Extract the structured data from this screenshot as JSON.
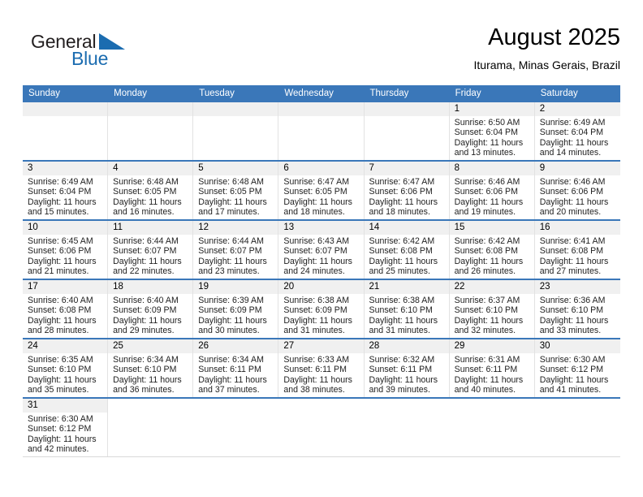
{
  "brand": {
    "name_part1": "General",
    "name_part2": "Blue",
    "triangle_color": "#1b6cb0",
    "text_color": "#231f20"
  },
  "header": {
    "title": "August 2025",
    "subtitle": "Iturama, Minas Gerais, Brazil"
  },
  "theme": {
    "header_row_bg": "#3a77b9",
    "header_row_text": "#ffffff",
    "daynum_bg": "#f0f0f0",
    "grid_line": "#e2e2e2",
    "week_divider": "#3a77b9"
  },
  "weekdays": [
    "Sunday",
    "Monday",
    "Tuesday",
    "Wednesday",
    "Thursday",
    "Friday",
    "Saturday"
  ],
  "weeks": [
    [
      {
        "day": "",
        "sunrise": "",
        "sunset": "",
        "daylight_line1": "",
        "daylight_line2": "",
        "type": "empty"
      },
      {
        "day": "",
        "sunrise": "",
        "sunset": "",
        "daylight_line1": "",
        "daylight_line2": "",
        "type": "empty"
      },
      {
        "day": "",
        "sunrise": "",
        "sunset": "",
        "daylight_line1": "",
        "daylight_line2": "",
        "type": "empty"
      },
      {
        "day": "",
        "sunrise": "",
        "sunset": "",
        "daylight_line1": "",
        "daylight_line2": "",
        "type": "empty"
      },
      {
        "day": "",
        "sunrise": "",
        "sunset": "",
        "daylight_line1": "",
        "daylight_line2": "",
        "type": "empty"
      },
      {
        "day": "1",
        "sunrise": "Sunrise: 6:50 AM",
        "sunset": "Sunset: 6:04 PM",
        "daylight_line1": "Daylight: 11 hours",
        "daylight_line2": "and 13 minutes.",
        "type": "day"
      },
      {
        "day": "2",
        "sunrise": "Sunrise: 6:49 AM",
        "sunset": "Sunset: 6:04 PM",
        "daylight_line1": "Daylight: 11 hours",
        "daylight_line2": "and 14 minutes.",
        "type": "day"
      }
    ],
    [
      {
        "day": "3",
        "sunrise": "Sunrise: 6:49 AM",
        "sunset": "Sunset: 6:04 PM",
        "daylight_line1": "Daylight: 11 hours",
        "daylight_line2": "and 15 minutes.",
        "type": "day"
      },
      {
        "day": "4",
        "sunrise": "Sunrise: 6:48 AM",
        "sunset": "Sunset: 6:05 PM",
        "daylight_line1": "Daylight: 11 hours",
        "daylight_line2": "and 16 minutes.",
        "type": "day"
      },
      {
        "day": "5",
        "sunrise": "Sunrise: 6:48 AM",
        "sunset": "Sunset: 6:05 PM",
        "daylight_line1": "Daylight: 11 hours",
        "daylight_line2": "and 17 minutes.",
        "type": "day"
      },
      {
        "day": "6",
        "sunrise": "Sunrise: 6:47 AM",
        "sunset": "Sunset: 6:05 PM",
        "daylight_line1": "Daylight: 11 hours",
        "daylight_line2": "and 18 minutes.",
        "type": "day"
      },
      {
        "day": "7",
        "sunrise": "Sunrise: 6:47 AM",
        "sunset": "Sunset: 6:06 PM",
        "daylight_line1": "Daylight: 11 hours",
        "daylight_line2": "and 18 minutes.",
        "type": "day"
      },
      {
        "day": "8",
        "sunrise": "Sunrise: 6:46 AM",
        "sunset": "Sunset: 6:06 PM",
        "daylight_line1": "Daylight: 11 hours",
        "daylight_line2": "and 19 minutes.",
        "type": "day"
      },
      {
        "day": "9",
        "sunrise": "Sunrise: 6:46 AM",
        "sunset": "Sunset: 6:06 PM",
        "daylight_line1": "Daylight: 11 hours",
        "daylight_line2": "and 20 minutes.",
        "type": "day"
      }
    ],
    [
      {
        "day": "10",
        "sunrise": "Sunrise: 6:45 AM",
        "sunset": "Sunset: 6:06 PM",
        "daylight_line1": "Daylight: 11 hours",
        "daylight_line2": "and 21 minutes.",
        "type": "day"
      },
      {
        "day": "11",
        "sunrise": "Sunrise: 6:44 AM",
        "sunset": "Sunset: 6:07 PM",
        "daylight_line1": "Daylight: 11 hours",
        "daylight_line2": "and 22 minutes.",
        "type": "day"
      },
      {
        "day": "12",
        "sunrise": "Sunrise: 6:44 AM",
        "sunset": "Sunset: 6:07 PM",
        "daylight_line1": "Daylight: 11 hours",
        "daylight_line2": "and 23 minutes.",
        "type": "day"
      },
      {
        "day": "13",
        "sunrise": "Sunrise: 6:43 AM",
        "sunset": "Sunset: 6:07 PM",
        "daylight_line1": "Daylight: 11 hours",
        "daylight_line2": "and 24 minutes.",
        "type": "day"
      },
      {
        "day": "14",
        "sunrise": "Sunrise: 6:42 AM",
        "sunset": "Sunset: 6:08 PM",
        "daylight_line1": "Daylight: 11 hours",
        "daylight_line2": "and 25 minutes.",
        "type": "day"
      },
      {
        "day": "15",
        "sunrise": "Sunrise: 6:42 AM",
        "sunset": "Sunset: 6:08 PM",
        "daylight_line1": "Daylight: 11 hours",
        "daylight_line2": "and 26 minutes.",
        "type": "day"
      },
      {
        "day": "16",
        "sunrise": "Sunrise: 6:41 AM",
        "sunset": "Sunset: 6:08 PM",
        "daylight_line1": "Daylight: 11 hours",
        "daylight_line2": "and 27 minutes.",
        "type": "day"
      }
    ],
    [
      {
        "day": "17",
        "sunrise": "Sunrise: 6:40 AM",
        "sunset": "Sunset: 6:08 PM",
        "daylight_line1": "Daylight: 11 hours",
        "daylight_line2": "and 28 minutes.",
        "type": "day"
      },
      {
        "day": "18",
        "sunrise": "Sunrise: 6:40 AM",
        "sunset": "Sunset: 6:09 PM",
        "daylight_line1": "Daylight: 11 hours",
        "daylight_line2": "and 29 minutes.",
        "type": "day"
      },
      {
        "day": "19",
        "sunrise": "Sunrise: 6:39 AM",
        "sunset": "Sunset: 6:09 PM",
        "daylight_line1": "Daylight: 11 hours",
        "daylight_line2": "and 30 minutes.",
        "type": "day"
      },
      {
        "day": "20",
        "sunrise": "Sunrise: 6:38 AM",
        "sunset": "Sunset: 6:09 PM",
        "daylight_line1": "Daylight: 11 hours",
        "daylight_line2": "and 31 minutes.",
        "type": "day"
      },
      {
        "day": "21",
        "sunrise": "Sunrise: 6:38 AM",
        "sunset": "Sunset: 6:10 PM",
        "daylight_line1": "Daylight: 11 hours",
        "daylight_line2": "and 31 minutes.",
        "type": "day"
      },
      {
        "day": "22",
        "sunrise": "Sunrise: 6:37 AM",
        "sunset": "Sunset: 6:10 PM",
        "daylight_line1": "Daylight: 11 hours",
        "daylight_line2": "and 32 minutes.",
        "type": "day"
      },
      {
        "day": "23",
        "sunrise": "Sunrise: 6:36 AM",
        "sunset": "Sunset: 6:10 PM",
        "daylight_line1": "Daylight: 11 hours",
        "daylight_line2": "and 33 minutes.",
        "type": "day"
      }
    ],
    [
      {
        "day": "24",
        "sunrise": "Sunrise: 6:35 AM",
        "sunset": "Sunset: 6:10 PM",
        "daylight_line1": "Daylight: 11 hours",
        "daylight_line2": "and 35 minutes.",
        "type": "day"
      },
      {
        "day": "25",
        "sunrise": "Sunrise: 6:34 AM",
        "sunset": "Sunset: 6:10 PM",
        "daylight_line1": "Daylight: 11 hours",
        "daylight_line2": "and 36 minutes.",
        "type": "day"
      },
      {
        "day": "26",
        "sunrise": "Sunrise: 6:34 AM",
        "sunset": "Sunset: 6:11 PM",
        "daylight_line1": "Daylight: 11 hours",
        "daylight_line2": "and 37 minutes.",
        "type": "day"
      },
      {
        "day": "27",
        "sunrise": "Sunrise: 6:33 AM",
        "sunset": "Sunset: 6:11 PM",
        "daylight_line1": "Daylight: 11 hours",
        "daylight_line2": "and 38 minutes.",
        "type": "day"
      },
      {
        "day": "28",
        "sunrise": "Sunrise: 6:32 AM",
        "sunset": "Sunset: 6:11 PM",
        "daylight_line1": "Daylight: 11 hours",
        "daylight_line2": "and 39 minutes.",
        "type": "day"
      },
      {
        "day": "29",
        "sunrise": "Sunrise: 6:31 AM",
        "sunset": "Sunset: 6:11 PM",
        "daylight_line1": "Daylight: 11 hours",
        "daylight_line2": "and 40 minutes.",
        "type": "day"
      },
      {
        "day": "30",
        "sunrise": "Sunrise: 6:30 AM",
        "sunset": "Sunset: 6:12 PM",
        "daylight_line1": "Daylight: 11 hours",
        "daylight_line2": "and 41 minutes.",
        "type": "day"
      }
    ],
    [
      {
        "day": "31",
        "sunrise": "Sunrise: 6:30 AM",
        "sunset": "Sunset: 6:12 PM",
        "daylight_line1": "Daylight: 11 hours",
        "daylight_line2": "and 42 minutes.",
        "type": "day"
      },
      {
        "day": "",
        "sunrise": "",
        "sunset": "",
        "daylight_line1": "",
        "daylight_line2": "",
        "type": "blank"
      },
      {
        "day": "",
        "sunrise": "",
        "sunset": "",
        "daylight_line1": "",
        "daylight_line2": "",
        "type": "blank"
      },
      {
        "day": "",
        "sunrise": "",
        "sunset": "",
        "daylight_line1": "",
        "daylight_line2": "",
        "type": "blank"
      },
      {
        "day": "",
        "sunrise": "",
        "sunset": "",
        "daylight_line1": "",
        "daylight_line2": "",
        "type": "blank"
      },
      {
        "day": "",
        "sunrise": "",
        "sunset": "",
        "daylight_line1": "",
        "daylight_line2": "",
        "type": "blank"
      },
      {
        "day": "",
        "sunrise": "",
        "sunset": "",
        "daylight_line1": "",
        "daylight_line2": "",
        "type": "blank"
      }
    ]
  ]
}
